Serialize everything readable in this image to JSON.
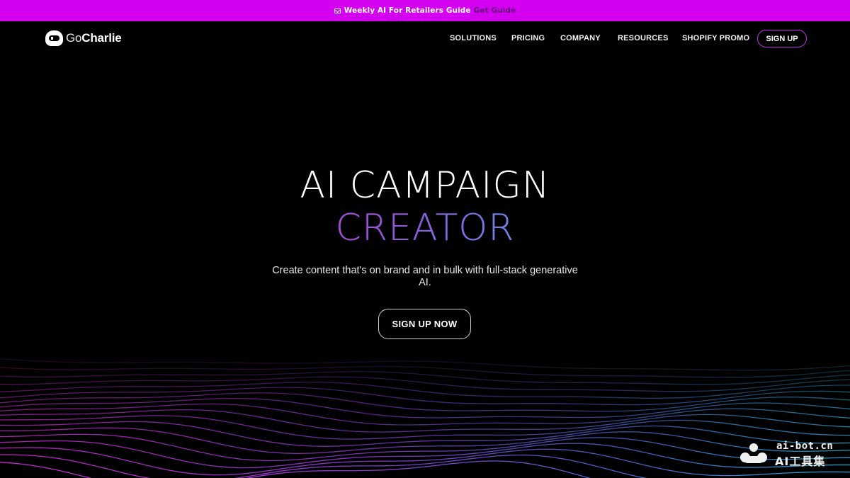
{
  "announcement": {
    "icon": "mail-icon",
    "text": "Weekly AI For Retailers Guide",
    "link": "Get Guide",
    "background": "#d400f0"
  },
  "header": {
    "logo": {
      "prefix": "Go",
      "name": "Charlie"
    },
    "menu": [
      {
        "label": "SOLUTIONS"
      },
      {
        "label": "PRICING"
      },
      {
        "label": "COMPANY"
      },
      {
        "label": "RESOURCES"
      },
      {
        "label": "SHOPIFY PROMO"
      }
    ],
    "signup_label": "SIGN UP",
    "signup_border_color": "#c02cf0"
  },
  "hero": {
    "title_line1": "AI CAMPAIGN",
    "title_line2": "CREATOR",
    "description": "Create content that's on brand and in bulk with full-stack generative AI.",
    "cta_label": "SIGN UP NOW",
    "gradient_colors": [
      "#a24ad8",
      "#5b8fe6"
    ]
  },
  "waves": {
    "colors": [
      "#d12ad6",
      "#2fb9e6"
    ]
  },
  "watermark": {
    "site": "ai-bot.cn",
    "name": "AI工具集"
  }
}
